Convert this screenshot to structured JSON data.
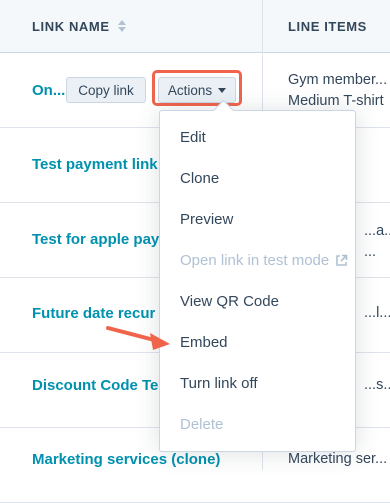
{
  "table": {
    "headers": {
      "link_name": "LINK NAME",
      "line_items": "LINE ITEMS"
    },
    "rows": [
      {
        "name": "On...",
        "items": [
          "Gym member...",
          "Medium T-shirt"
        ]
      },
      {
        "name": "Test payment link",
        "items": []
      },
      {
        "name": "Test for apple pay",
        "items": [
          "...a...",
          "..."
        ]
      },
      {
        "name": "Future date recur",
        "items": [
          "...l..."
        ]
      },
      {
        "name": "Discount Code Tes",
        "items": [
          "...s..."
        ]
      },
      {
        "name": "Marketing services (clone)",
        "items": [
          "Marketing ser..."
        ]
      }
    ]
  },
  "row_buttons": {
    "copy_link": "Copy link",
    "actions": "Actions"
  },
  "menu": {
    "items": [
      {
        "label": "Edit",
        "enabled": true
      },
      {
        "label": "Clone",
        "enabled": true
      },
      {
        "label": "Preview",
        "enabled": true
      },
      {
        "label": "Open link in test mode",
        "enabled": false,
        "icon": "external-link-icon"
      },
      {
        "label": "View QR Code",
        "enabled": true
      },
      {
        "label": "Embed",
        "enabled": true
      },
      {
        "label": "Turn link off",
        "enabled": true
      },
      {
        "label": "Delete",
        "enabled": false
      }
    ]
  },
  "colors": {
    "link": "#0091ae",
    "highlight": "#f0644c",
    "disabled": "#b0c1d4",
    "text": "#33475b"
  }
}
